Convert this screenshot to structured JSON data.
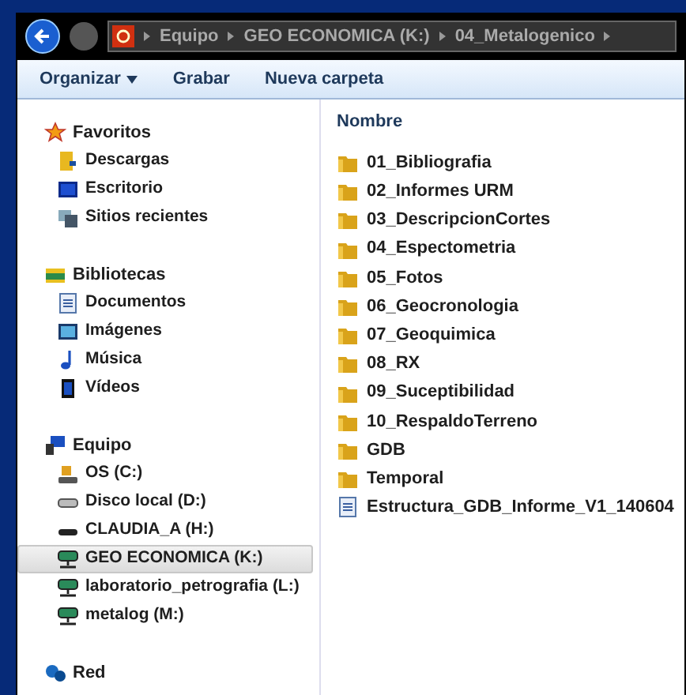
{
  "address_bar": {
    "crumbs": [
      "Equipo",
      "GEO ECONOMICA (K:)",
      "04_Metalogenico"
    ]
  },
  "toolbar": {
    "buttons": [
      {
        "label": "Organizar",
        "dropdown": true
      },
      {
        "label": "Grabar",
        "dropdown": false
      },
      {
        "label": "Nueva carpeta",
        "dropdown": false
      }
    ]
  },
  "sidebar": {
    "groups": [
      {
        "label": "Favoritos",
        "kind": "star",
        "items": [
          {
            "label": "Descargas",
            "kind": "downloads",
            "selected": false
          },
          {
            "label": "Escritorio",
            "kind": "desktop",
            "selected": false
          },
          {
            "label": "Sitios recientes",
            "kind": "recent",
            "selected": false
          }
        ]
      },
      {
        "label": "Bibliotecas",
        "kind": "library",
        "items": [
          {
            "label": "Documentos",
            "kind": "document",
            "selected": false
          },
          {
            "label": "Imágenes",
            "kind": "image",
            "selected": false
          },
          {
            "label": "Música",
            "kind": "music",
            "selected": false
          },
          {
            "label": "Vídeos",
            "kind": "video",
            "selected": false
          }
        ]
      },
      {
        "label": "Equipo",
        "kind": "computer",
        "items": [
          {
            "label": "OS (C:)",
            "kind": "system-drive",
            "selected": false
          },
          {
            "label": "Disco local (D:)",
            "kind": "drive",
            "selected": false
          },
          {
            "label": "CLAUDIA_A (H:)",
            "kind": "removable",
            "selected": false
          },
          {
            "label": "GEO ECONOMICA (K:)",
            "kind": "network",
            "selected": true
          },
          {
            "label": "laboratorio_petrografia (L:)",
            "kind": "network",
            "selected": false
          },
          {
            "label": "metalog (M:)",
            "kind": "network",
            "selected": false
          }
        ]
      },
      {
        "label": "Red",
        "kind": "network-globe"
      }
    ]
  },
  "file_list": {
    "columns": [
      "Nombre"
    ],
    "rows": [
      {
        "name": "01_Bibliografia",
        "kind": "folder"
      },
      {
        "name": "02_Informes URM",
        "kind": "folder"
      },
      {
        "name": "03_DescripcionCortes",
        "kind": "folder"
      },
      {
        "name": "04_Espectometria",
        "kind": "folder"
      },
      {
        "name": "05_Fotos",
        "kind": "folder"
      },
      {
        "name": "06_Geocronologia",
        "kind": "folder"
      },
      {
        "name": "07_Geoquimica",
        "kind": "folder"
      },
      {
        "name": "08_RX",
        "kind": "folder"
      },
      {
        "name": "09_Suceptibilidad",
        "kind": "folder"
      },
      {
        "name": "10_RespaldoTerreno",
        "kind": "folder"
      },
      {
        "name": "GDB",
        "kind": "folder"
      },
      {
        "name": "Temporal",
        "kind": "folder"
      },
      {
        "name": "Estructura_GDB_Informe_V1_140604",
        "kind": "document"
      }
    ]
  }
}
